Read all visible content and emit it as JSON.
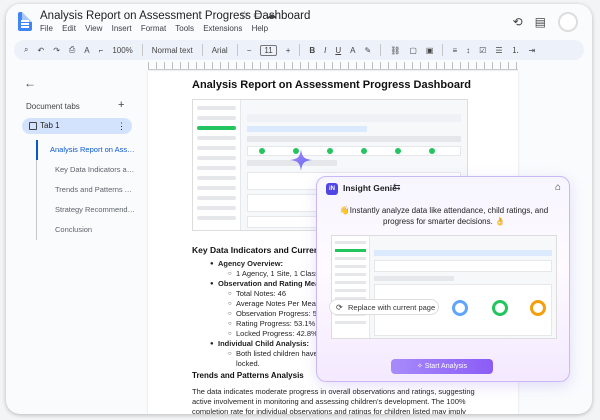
{
  "document": {
    "title": "Analysis Report on Assessment Progress Dashboard",
    "menu": [
      "File",
      "Edit",
      "View",
      "Insert",
      "Format",
      "Tools",
      "Extensions",
      "Help"
    ]
  },
  "toolbar": {
    "zoom": "100%",
    "style": "Normal text",
    "font": "Arial",
    "font_size": "11"
  },
  "sidebar": {
    "heading": "Document tabs",
    "tab": "Tab 1",
    "outline": [
      "Analysis Report on Asses...",
      "Key Data Indicators an...",
      "Trends and Patterns An...",
      "Strategy Recommendar...",
      "Conclusion"
    ]
  },
  "page": {
    "heading": "Analysis Report on Assessment Progress Dashboard",
    "section_title": "Key Data Indicators and Current",
    "agency_label": "Agency Overview:",
    "agency_detail": "1 Agency, 1 Site, 1 Classro",
    "observation_label": "Observation and Rating Measur",
    "total_notes": "Total Notes: 46",
    "avg_notes": "Average Notes Per Measu",
    "obs_progress": "Observation Progress: 57.",
    "rating_progress": "Rating Progress: 53.1% C",
    "locked_progress": "Locked Progress: 42.8% C",
    "child_label": "Individual Child Analysis:",
    "child_detail_1": "Both listed children have 1",
    "child_detail_2": "locked.",
    "trends_title": "Trends and Patterns Analysis",
    "trends_para": "The data indicates moderate progress in overall observations and ratings, suggesting active involvement in monitoring and assessing children's development. The 100% completion rate for individual observations and ratings for children listed may imply efficient processes at the"
  },
  "genie": {
    "name": "Insight Genie",
    "message": "👋Instantly analyze data like attendance, child ratings, and progress for smarter decisions. 👌",
    "replace_label": "Replace with current page",
    "start_label": "Start Analysis"
  }
}
